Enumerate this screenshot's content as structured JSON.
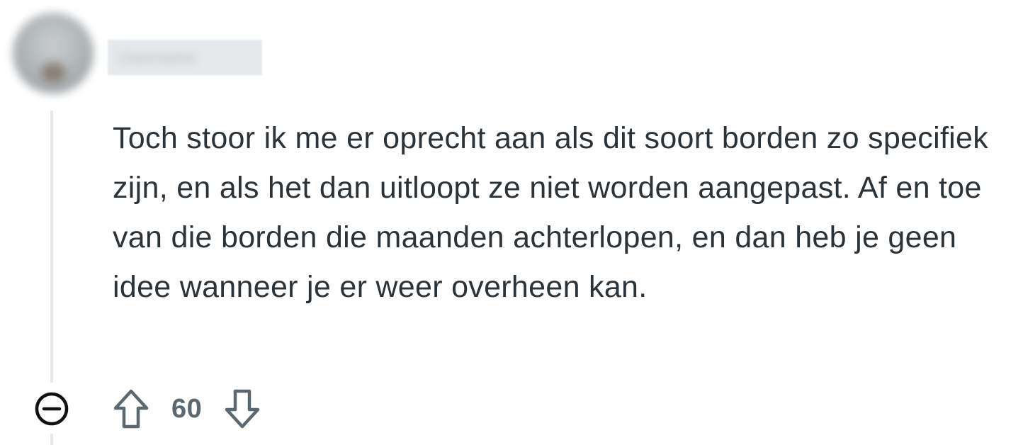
{
  "comment": {
    "author": "Username",
    "body": "Toch stoor ik me er oprecht aan als dit soort borden zo specifiek zijn, en als het dan uitloopt ze niet worden aangepast. Af en toe van die borden die maanden achterlopen, en dan heb je geen idee wanneer je er weer overheen kan.",
    "score": "60"
  },
  "icons": {
    "collapse": "minus-circle-icon",
    "upvote": "arrow-up-icon",
    "downvote": "arrow-down-icon"
  },
  "colors": {
    "text": "#2b3338",
    "score": "#5c6870",
    "icon": "#5c6870",
    "thread_line": "#e6e8ea"
  }
}
